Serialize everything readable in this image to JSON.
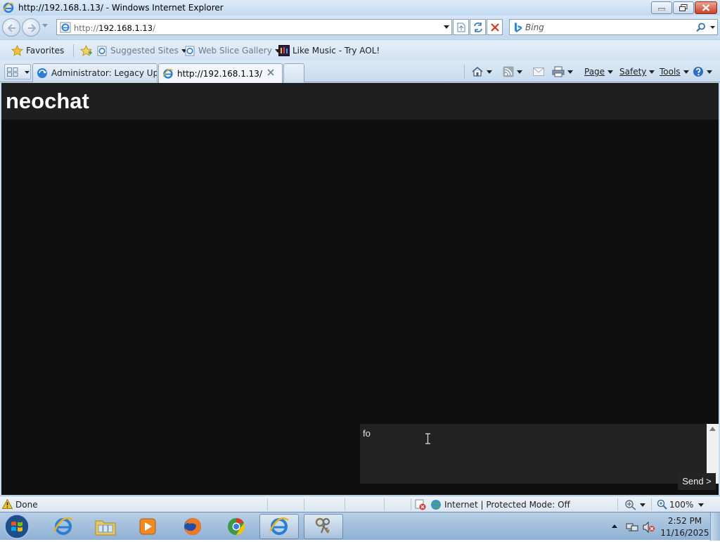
{
  "window": {
    "title": "http://192.168.1.13/ - Windows Internet Explorer"
  },
  "navigation": {
    "address_protocol": "http://",
    "address_host": "192.168.1.13",
    "address_path": "/",
    "search_placeholder": "Bing"
  },
  "favorites_bar": {
    "favorites_label": "Favorites",
    "items": [
      {
        "label": "Suggested Sites",
        "icon": "ie-page-icon"
      },
      {
        "label": "Web Slice Gallery",
        "icon": "ie-page-icon"
      },
      {
        "label": "Like Music - Try AOL!",
        "icon": "aol-music-icon"
      }
    ]
  },
  "tabs": [
    {
      "label": "Administrator: Legacy Upd...",
      "active": false,
      "icon": "update-globe-icon"
    },
    {
      "label": "http://192.168.1.13/",
      "active": true,
      "icon": "ie-icon"
    }
  ],
  "command_bar": {
    "page_label": "Page",
    "safety_label": "Safety",
    "tools_label": "Tools"
  },
  "app": {
    "title": "neochat",
    "composer_value": "fo",
    "send_label": "Send >",
    "colors": {
      "background": "#0f0f0f",
      "header": "#1f1f1f",
      "composer": "#222222",
      "text": "#ffffff"
    }
  },
  "status_bar": {
    "status_text": "Done",
    "zone_text": "Internet | Protected Mode: Off",
    "zoom": "100%"
  },
  "taskbar": {
    "apps": [
      "internet-explorer",
      "windows-explorer",
      "media-player",
      "firefox",
      "chrome",
      "internet-explorer-active",
      "keys-tool"
    ],
    "clock_time": "2:52 PM",
    "clock_date": "11/16/2025"
  }
}
